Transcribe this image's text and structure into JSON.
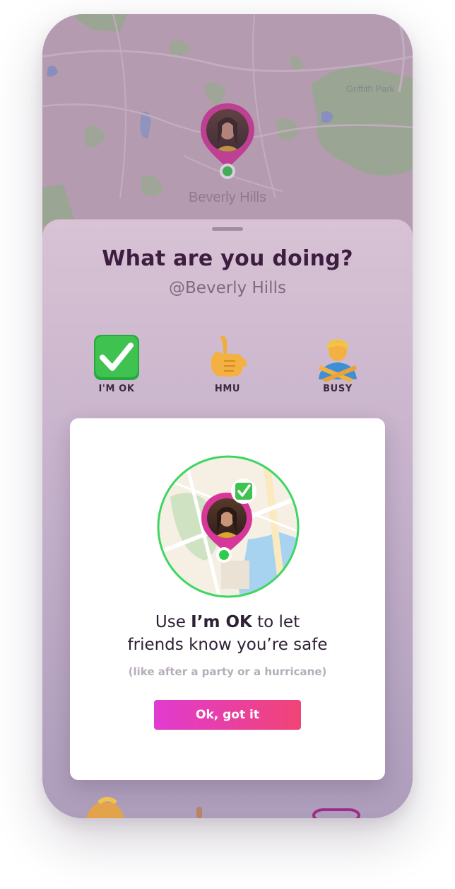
{
  "map": {
    "place_label": "Beverly Hills",
    "park_label": "Griffith Park"
  },
  "sheet": {
    "title": "What are you doing?",
    "location": "@Beverly Hills",
    "statuses": [
      {
        "label": "I'M OK",
        "icon": "check-mark-icon"
      },
      {
        "label": "HMU",
        "icon": "call-me-hand-icon"
      },
      {
        "label": "BUSY",
        "icon": "crossed-arms-person-icon"
      }
    ]
  },
  "modal": {
    "line1_prefix": "Use ",
    "line1_bold": "I’m OK",
    "line1_suffix": " to let",
    "line2": "friends know you’re safe",
    "note": "(like after a party or a hurricane)",
    "button_label": "Ok, got it"
  },
  "colors": {
    "brand_magenta": "#d8379a",
    "button_gradient_start": "#e03bd0",
    "button_gradient_end": "#f14476",
    "ok_green": "#2ecc4a",
    "title_purple": "#3d1d40"
  }
}
